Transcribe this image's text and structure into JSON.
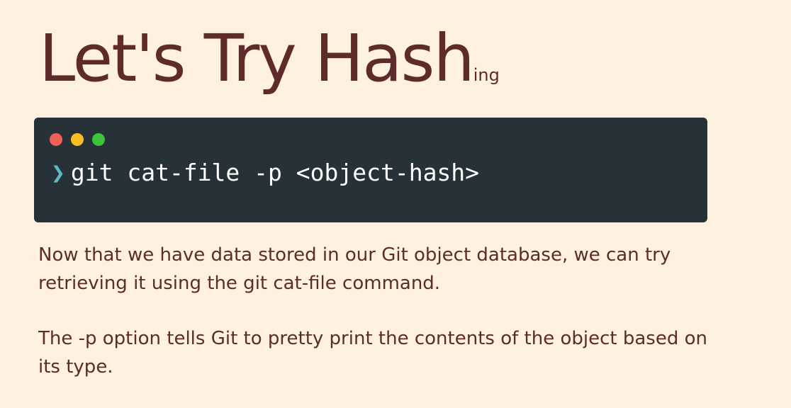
{
  "title": {
    "main": "Let's Try Hash",
    "suffix": "ing"
  },
  "terminal": {
    "dots": {
      "red": "#f25f58",
      "yellow": "#fbbe22",
      "green": "#3ec33b"
    },
    "prompt_icon": "chevron-right-icon",
    "command": "git cat-file -p <object-hash>"
  },
  "paragraphs": [
    "Now that we have data stored in our Git object database, we can try retrieving it using the git cat-file command.",
    "The -p option tells Git to pretty print the contents of the object based on its type."
  ]
}
